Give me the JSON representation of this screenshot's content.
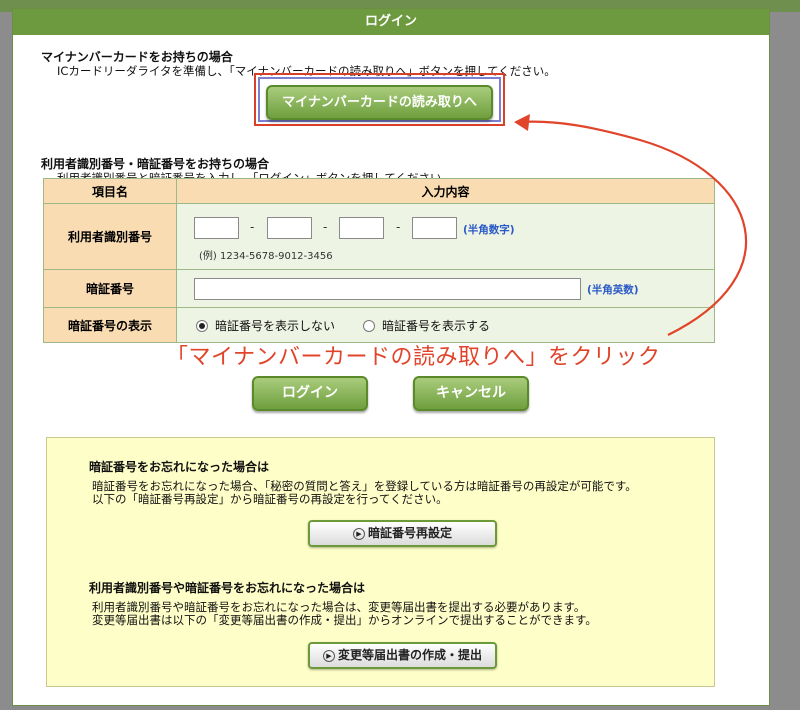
{
  "dialog": {
    "title": "ログイン"
  },
  "mynumber": {
    "heading": "マイナンバーカードをお持ちの場合",
    "desc": "ICカードリーダライタを準備し、「マイナンバーカードの読み取りへ」ボタンを押してください。",
    "button_label": "マイナンバーカードの読み取りへ"
  },
  "idpass": {
    "heading": "利用者識別番号・暗証番号をお持ちの場合",
    "desc": "利用者識別番号と暗証番号を入力し、「ログイン」ボタンを押してください。"
  },
  "table": {
    "headers": [
      "項目名",
      "入力内容"
    ],
    "user_id_label": "利用者識別番号",
    "user_id_sep": "-",
    "user_id_hint": "(半角数字)",
    "user_id_example": "(例) 1234-5678-9012-3456",
    "password_label": "暗証番号",
    "password_hint": "(半角英数)",
    "display_label": "暗証番号の表示",
    "display_options": [
      "暗証番号を表示しない",
      "暗証番号を表示する"
    ],
    "display_selected": "暗証番号を表示しない"
  },
  "annotation": "「マイナンバーカードの読み取りへ」をクリック",
  "buttons": {
    "login": "ログイン",
    "cancel": "キャンセル"
  },
  "help": {
    "password_heading": "暗証番号をお忘れになった場合は",
    "password_text_1": "暗証番号をお忘れになった場合、「秘密の質問と答え」を登録している方は暗証番号の再設定が可能です。",
    "password_text_2": "以下の「暗証番号再設定」から暗証番号の再設定を行ってください。",
    "password_button": "暗証番号再設定",
    "both_heading": "利用者識別番号や暗証番号をお忘れになった場合は",
    "both_text_1": "利用者識別番号や暗証番号をお忘れになった場合は、変更等届出書を提出する必要があります。",
    "both_text_2": "変更等届出書は以下の「変更等届出書の作成・提出」からオンラインで提出することができます。",
    "both_button": "変更等届出書の作成・提出"
  },
  "colors": {
    "accent": "#6e9a3f",
    "annotation": "#e0442a",
    "highlight": "#d8402a"
  }
}
